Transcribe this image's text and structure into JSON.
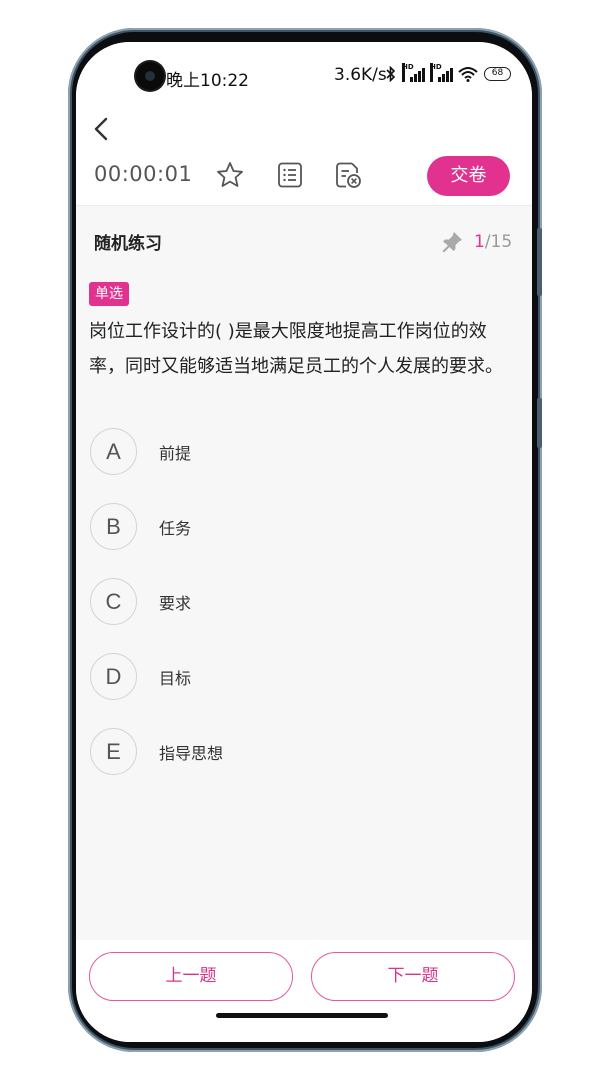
{
  "status_bar": {
    "time": "晚上10:22",
    "network_speed": "3.6K/s",
    "battery_level": "68",
    "icons": [
      "bluetooth-icon",
      "hd-signal-icon",
      "hd-signal-icon",
      "wifi-icon",
      "battery-icon"
    ]
  },
  "header": {
    "back_icon": "chevron-left-icon",
    "timer": "00:00:01",
    "icons": [
      "star-icon",
      "list-icon",
      "document-delete-icon"
    ],
    "submit_label": "交卷"
  },
  "quiz": {
    "title": "随机练习",
    "pin_icon": "pin-icon",
    "current": "1",
    "total": "/15",
    "type_tag": "单选",
    "question": "岗位工作设计的( )是最大限度地提高工作岗位的效率，同时又能够适当地满足员工的个人发展的要求。",
    "options": [
      {
        "letter": "A",
        "text": "前提"
      },
      {
        "letter": "B",
        "text": "任务"
      },
      {
        "letter": "C",
        "text": "要求"
      },
      {
        "letter": "D",
        "text": "目标"
      },
      {
        "letter": "E",
        "text": "指导思想"
      }
    ]
  },
  "footer": {
    "prev_label": "上一题",
    "next_label": "下一题"
  },
  "colors": {
    "accent": "#e2328f",
    "background": "#f7f7f7",
    "frame": "#3e5566"
  }
}
